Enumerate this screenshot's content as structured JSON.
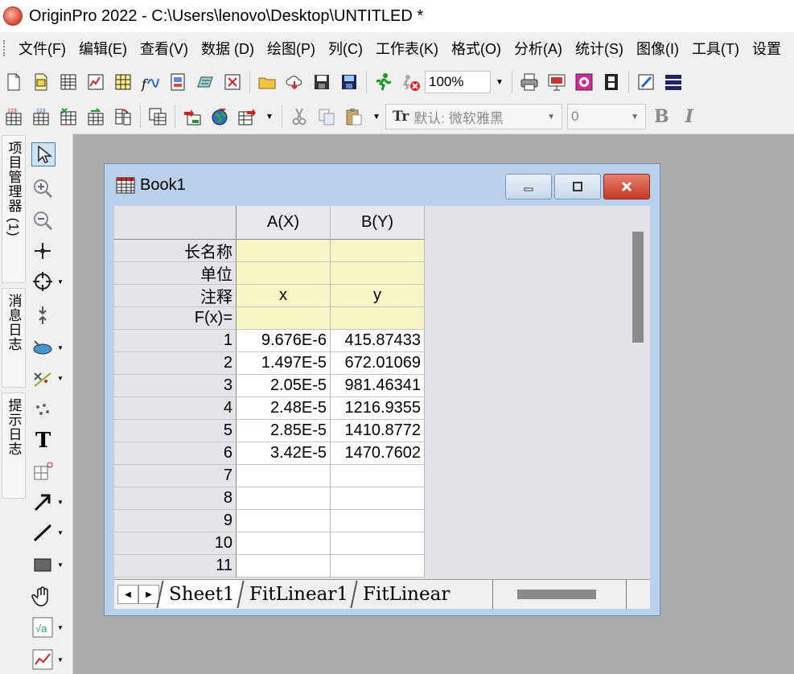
{
  "window": {
    "title": "OriginPro 2022 - C:\\Users\\lenovo\\Desktop\\UNTITLED *"
  },
  "menu": [
    "文件(F)",
    "编辑(E)",
    "查看(V)",
    "数据 (D)",
    "绘图(P)",
    "列(C)",
    "工作表(K)",
    "格式(O)",
    "分析(A)",
    "统计(S)",
    "图像(I)",
    "工具(T)",
    "设置"
  ],
  "toolbar": {
    "zoom": "100%",
    "font_name": "默认: 微软雅黑",
    "font_size": "0",
    "bold_label": "B",
    "italic_label": "I",
    "font_prefix": "Tr"
  },
  "side_tabs": [
    "项目管理器 (1)",
    "消息日志",
    "提示日志"
  ],
  "book": {
    "title": "Book1",
    "columns": [
      "A(X)",
      "B(Y)"
    ],
    "meta_rows": [
      {
        "label": "长名称",
        "a": "",
        "b": ""
      },
      {
        "label": "单位",
        "a": "",
        "b": ""
      },
      {
        "label": "注释",
        "a": "x",
        "b": "y"
      },
      {
        "label": "F(x)=",
        "a": "",
        "b": ""
      }
    ],
    "rows": [
      {
        "n": "1",
        "a": "9.676E-6",
        "b": "415.87433"
      },
      {
        "n": "2",
        "a": "1.497E-5",
        "b": "672.01069"
      },
      {
        "n": "3",
        "a": "2.05E-5",
        "b": "981.46341"
      },
      {
        "n": "4",
        "a": "2.48E-5",
        "b": "1216.9355"
      },
      {
        "n": "5",
        "a": "2.85E-5",
        "b": "1410.8772"
      },
      {
        "n": "6",
        "a": "3.42E-5",
        "b": "1470.7602"
      },
      {
        "n": "7",
        "a": "",
        "b": ""
      },
      {
        "n": "8",
        "a": "",
        "b": ""
      },
      {
        "n": "9",
        "a": "",
        "b": ""
      },
      {
        "n": "10",
        "a": "",
        "b": ""
      },
      {
        "n": "11",
        "a": "",
        "b": ""
      }
    ],
    "sheet_tabs": [
      "Sheet1",
      "FitLinear1",
      "FitLinear"
    ]
  },
  "colors": {
    "desktop": "#ababab",
    "meta_fill": "#f6f7c5",
    "book_frame": "#b9d1ea",
    "close_button": "#c63a24"
  },
  "icons": {
    "toolbar1": [
      "new-project-icon",
      "open-icon",
      "new-workbook-icon",
      "new-graph-icon",
      "new-matrix-icon",
      "function-graph-icon",
      "new-layout-icon",
      "notes-icon",
      "new-excel-icon",
      "open-folder-icon",
      "cloud-icon",
      "save-icon",
      "save-template-icon",
      "run-icon",
      "stop-icon",
      "print-icon",
      "slide-show-icon",
      "color-icon",
      "film-icon",
      "code-builder-icon",
      "window-list-icon"
    ],
    "toolbar2": [
      "add-column-icon",
      "set-values-icon",
      "sort-icon",
      "transpose-icon",
      "stack-icon",
      "worksheet-icon",
      "import-icon",
      "globe-icon",
      "export-icon",
      "cut-icon",
      "copy-icon",
      "paste-icon"
    ],
    "tools": [
      "pointer-icon",
      "zoom-in-icon",
      "zoom-out-icon",
      "screen-reader-icon",
      "data-reader-icon",
      "data-selector-icon",
      "mask-icon",
      "draw-data-icon",
      "region-icon",
      "text-icon",
      "insert-table-icon",
      "arrow-icon",
      "line-icon",
      "rectangle-icon",
      "hand-icon",
      "equation-icon",
      "graph-object-icon"
    ]
  }
}
